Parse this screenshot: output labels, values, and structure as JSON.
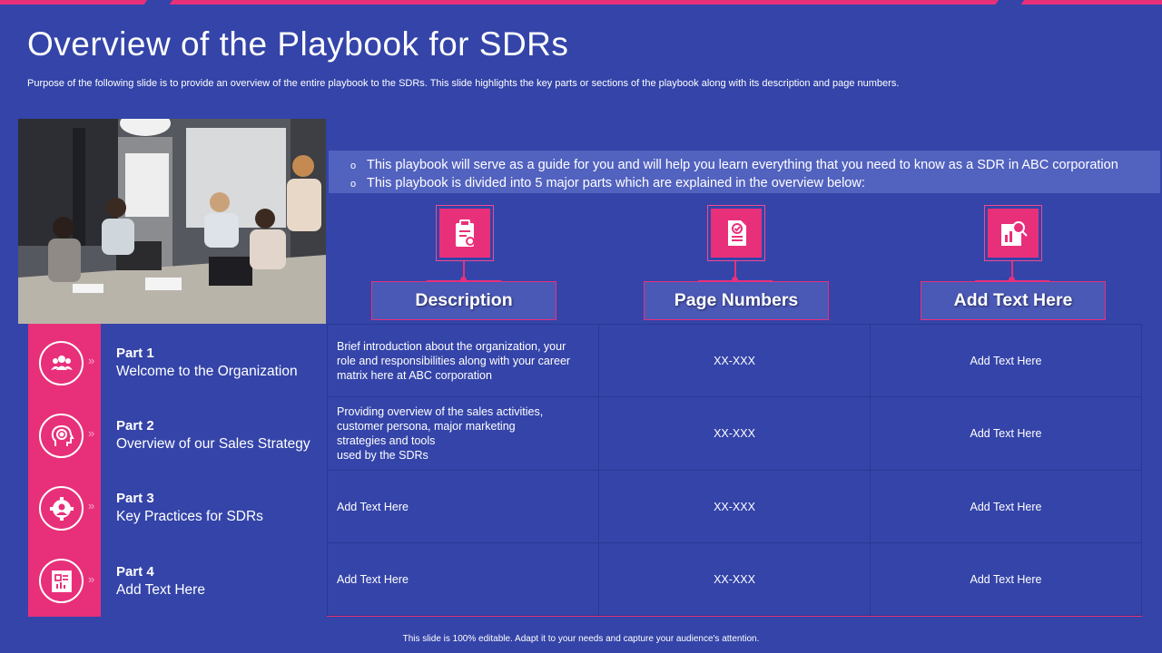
{
  "title": "Overview of the Playbook for SDRs",
  "subtitle": "Purpose of the following slide is to provide an overview of the entire playbook to the SDRs. This slide highlights the key parts or sections of the playbook along with its description and page numbers.",
  "intro": {
    "lines": [
      "This playbook will serve as a guide for you and will help you learn everything that you need to know as a SDR in ABC corporation",
      "This playbook is divided into 5 major parts which are explained in the overview below:"
    ],
    "bullet": "o"
  },
  "columns": [
    {
      "label": "Description",
      "icon": "clipboard-icon"
    },
    {
      "label": "Page Numbers",
      "icon": "checklist-icon"
    },
    {
      "label": "Add Text Here",
      "icon": "report-search-icon"
    }
  ],
  "parts": [
    {
      "num": "Part 1",
      "name": "Welcome to the Organization",
      "icon": "group-icon",
      "description": [
        "Brief introduction about the organization, your",
        "role and responsibilities along with your career",
        "matrix here at ABC corporation"
      ],
      "pages": "XX-XXX",
      "extra": "Add Text Here"
    },
    {
      "num": "Part 2",
      "name": "Overview  of our Sales Strategy",
      "icon": "target-head-icon",
      "description": [
        "Providing overview  of the sales activities,",
        "customer persona, major marketing",
        "strategies and tools",
        "used by the SDRs"
      ],
      "pages": "XX-XXX",
      "extra": "Add Text Here"
    },
    {
      "num": "Part 3",
      "name": "Key Practices for SDRs",
      "icon": "gear-person-icon",
      "description": [
        "Add Text Here"
      ],
      "pages": "XX-XXX",
      "extra": "Add Text Here"
    },
    {
      "num": "Part 4",
      "name": "Add Text Here",
      "icon": "document-chart-icon",
      "description": [
        "Add Text Here"
      ],
      "pages": "XX-XXX",
      "extra": "Add Text Here"
    }
  ],
  "chevron": "»",
  "footer": "This slide is 100% editable.  Adapt it to your needs and capture your audience's attention.",
  "colors": {
    "background": "#3444a8",
    "accent": "#e8307a",
    "header_fill": "#4a58b6"
  }
}
